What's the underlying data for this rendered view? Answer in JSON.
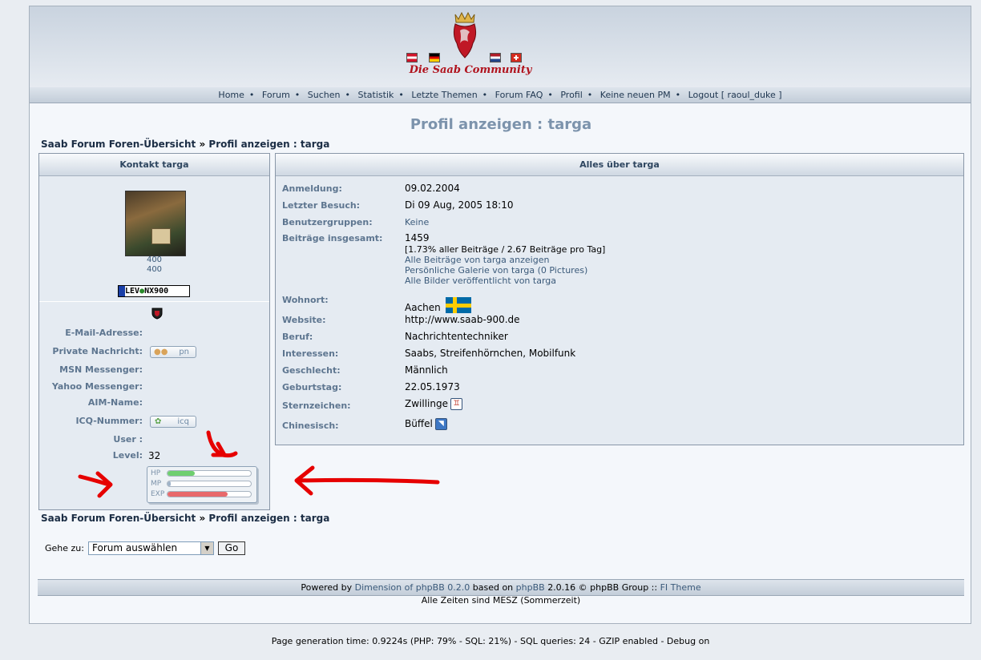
{
  "header": {
    "logo_text": "Die Saab Community"
  },
  "nav": {
    "items": [
      "Home",
      "Forum",
      "Suchen",
      "Statistik",
      "Letzte Themen",
      "Forum FAQ",
      "Profil",
      "Keine neuen PM",
      "Logout [ raoul_duke ]"
    ]
  },
  "page": {
    "title": "Profil anzeigen : targa"
  },
  "breadcrumb": {
    "home": "Saab Forum Foren-Übersicht",
    "sep": "»",
    "current": "Profil anzeigen : targa"
  },
  "contact": {
    "heading": "Kontakt targa",
    "avatar_num1": "400",
    "avatar_num2": "400",
    "plate_left": "LEV",
    "plate_right": "NX900",
    "email_label": "E-Mail-Adresse:",
    "pm_label": "Private Nachricht:",
    "pm_button": "pn",
    "msn_label": "MSN Messenger:",
    "yahoo_label": "Yahoo Messenger:",
    "aim_label": "AIM-Name:",
    "icq_label": "ICQ-Nummer:",
    "icq_button": "icq",
    "user_label": "User :",
    "level_label": "Level:",
    "level_value": "32",
    "stats": [
      {
        "label": "HP",
        "fill": 0.33,
        "color": "#6fcf6f"
      },
      {
        "label": "MP",
        "fill": 0.04,
        "color": "#9fb3c8"
      },
      {
        "label": "EXP",
        "fill": 0.72,
        "color": "#e8696b"
      }
    ]
  },
  "about": {
    "heading": "Alles über targa",
    "rows": [
      {
        "label": "Anmeldung:",
        "value": "09.02.2004"
      },
      {
        "label": "Letzter Besuch:",
        "value": "Di 09 Aug, 2005 18:10"
      },
      {
        "label": "Benutzergruppen:",
        "value": "Keine"
      },
      {
        "label": "Beiträge insgesamt:",
        "value": "1459"
      },
      {
        "label": "Wohnort:",
        "value": "Aachen"
      },
      {
        "label": "Website:",
        "value": "http://www.saab-900.de"
      },
      {
        "label": "Beruf:",
        "value": "Nachrichtentechniker"
      },
      {
        "label": "Interessen:",
        "value": "Saabs, Streifenhörnchen, Mobilfunk"
      },
      {
        "label": "Geschlecht:",
        "value": "Männlich"
      },
      {
        "label": "Geburtstag:",
        "value": "22.05.1973"
      },
      {
        "label": "Sternzeichen:",
        "value": "Zwillinge"
      },
      {
        "label": "Chinesisch:",
        "value": "Büffel"
      }
    ],
    "posts_pct": "[1.73% aller Beiträge / 2.67 Beiträge pro Tag]",
    "posts_link1": "Alle Beiträge von targa anzeigen",
    "posts_link2": "Persönliche Galerie von targa (0 Pictures)",
    "posts_link3": "Alle Bilder veröffentlicht von targa"
  },
  "jump": {
    "label": "Gehe zu:",
    "selected": "Forum auswählen",
    "button": "Go"
  },
  "footer": {
    "powered_prefix": "Powered by",
    "powered_link1": "Dimension of phpBB 0.2.0",
    "based_on": "based on",
    "powered_link2": "phpBB",
    "group": "2.0.16 © phpBB Group ::",
    "theme": "FI Theme",
    "timezone": "Alle Zeiten sind MESZ (Sommerzeit)",
    "page_gen": "Page generation time: 0.9224s (PHP: 79% - SQL: 21%) - SQL queries: 24 - GZIP enabled - Debug on"
  }
}
